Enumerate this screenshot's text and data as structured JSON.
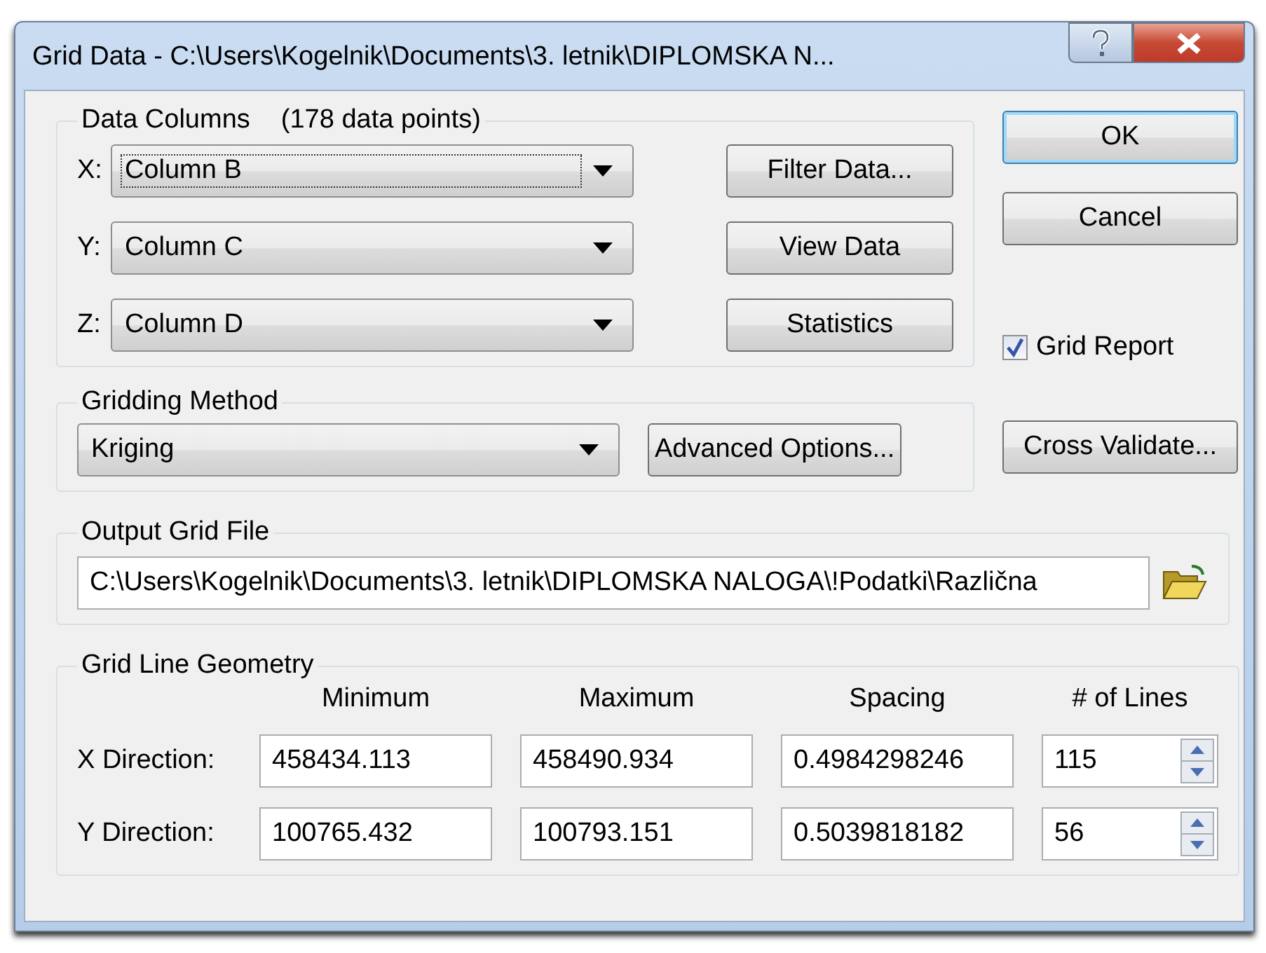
{
  "window": {
    "title": "Grid Data - C:\\Users\\Kogelnik\\Documents\\3. letnik\\DIPLOMSKA N..."
  },
  "data_columns": {
    "title": "Data Columns",
    "count": "(178 data points)",
    "columns": [
      {
        "axis": "X:",
        "value": "Column B",
        "focused": true
      },
      {
        "axis": "Y:",
        "value": "Column C",
        "focused": false
      },
      {
        "axis": "Z:",
        "value": "Column D",
        "focused": false
      }
    ],
    "buttons": [
      "Filter Data...",
      "View Data",
      "Statistics"
    ]
  },
  "dialog_buttons": [
    {
      "label": "OK",
      "default": true
    },
    {
      "label": "Cancel",
      "default": false
    }
  ],
  "grid_report": {
    "label": "Grid Report",
    "checked": true
  },
  "gridding_method": {
    "title": "Gridding Method",
    "value": "Kriging",
    "button": "Advanced Options..."
  },
  "cross_validate": {
    "label": "Cross Validate..."
  },
  "output_grid_file": {
    "title": "Output Grid File",
    "value": "C:\\Users\\Kogelnik\\Documents\\3. letnik\\DIPLOMSKA NALOGA\\!Podatki\\Različna"
  },
  "grid_line_geometry": {
    "title": "Grid Line Geometry",
    "columns": [
      "Minimum",
      "Maximum",
      "Spacing",
      "# of Lines"
    ],
    "rows": [
      {
        "label": "X Direction:",
        "minimum": "458434.113",
        "maximum": "458490.934",
        "spacing": "0.4984298246",
        "lines": "115"
      },
      {
        "label": "Y Direction:",
        "minimum": "100765.432",
        "maximum": "100793.151",
        "spacing": "0.5039818182",
        "lines": "56"
      }
    ]
  }
}
